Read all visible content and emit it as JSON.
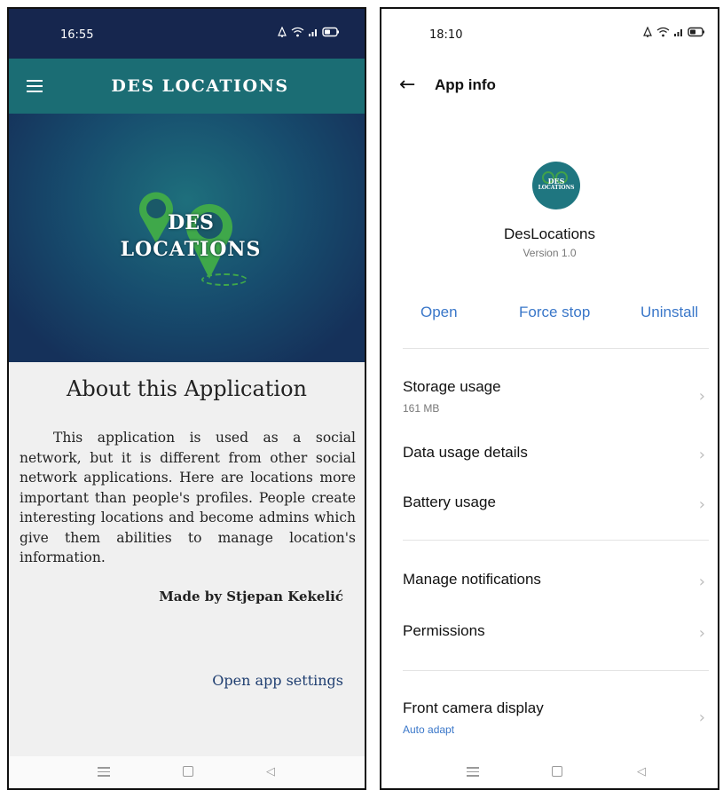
{
  "colors": {
    "left_status_bg": "#16264e",
    "appbar_bg": "#1b6d74",
    "link_blue": "#1f3e70",
    "accent_blue": "#3a77c9",
    "pin_green": "#3fa84a"
  },
  "left": {
    "status": {
      "time": "16:55",
      "icons": [
        "alarm-icon",
        "wifi-icon",
        "signal-icon",
        "battery-icon"
      ]
    },
    "appbar": {
      "menu_icon": "hamburger-icon",
      "title": "DES LOCATIONS"
    },
    "hero": {
      "logo_line1": "DES",
      "logo_line2": "LOCATIONS"
    },
    "about": {
      "title": "About this Application",
      "body": "This application is used as a social network, but it is different from other social network applications. Here are locations more important than people's profiles. People create interesting locations and become admins which give them abilities to manage location's information.",
      "made_by": "Made by Stjepan Kekelić",
      "open_settings": "Open app settings"
    },
    "navbar": {
      "icons": [
        "menu-icon",
        "home-icon",
        "back-icon"
      ]
    }
  },
  "right": {
    "status": {
      "time": "18:10",
      "icons": [
        "alarm-icon",
        "wifi-icon",
        "signal-icon",
        "battery-icon"
      ]
    },
    "header": {
      "back_icon": "back-arrow-icon",
      "title": "App info"
    },
    "app": {
      "icon_line1": "DES",
      "icon_line2": "LOCATIONS",
      "name": "DesLocations",
      "version": "Version 1.0"
    },
    "actions": {
      "open": "Open",
      "force_stop": "Force stop",
      "uninstall": "Uninstall"
    },
    "rows": {
      "storage": {
        "label": "Storage usage",
        "sub": "161 MB"
      },
      "data_usage": {
        "label": "Data usage details"
      },
      "battery": {
        "label": "Battery usage"
      },
      "notifications": {
        "label": "Manage notifications"
      },
      "permissions": {
        "label": "Permissions"
      },
      "front_camera": {
        "label": "Front camera display",
        "sub": "Auto adapt"
      }
    },
    "navbar": {
      "icons": [
        "menu-icon",
        "home-icon",
        "back-icon"
      ]
    }
  }
}
